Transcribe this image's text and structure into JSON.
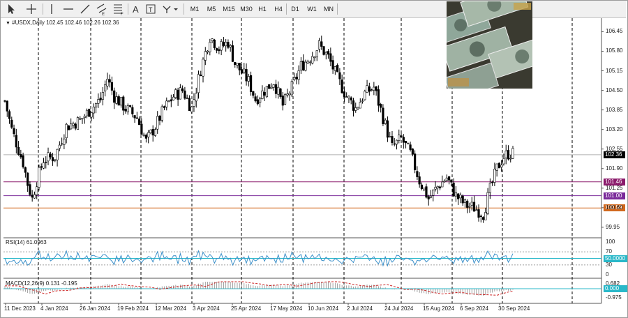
{
  "toolbar": {
    "timeframes": [
      "M1",
      "M5",
      "M15",
      "M30",
      "H1",
      "H4",
      "D1",
      "W1",
      "MN"
    ],
    "icons": [
      "cursor-icon",
      "crosshair-icon",
      "vertical-line-icon",
      "horizontal-line-icon",
      "trend-line-icon",
      "equidistant-channel-icon",
      "fibonacci-icon",
      "text-icon",
      "text-label-icon",
      "shapes-icon"
    ]
  },
  "header": {
    "text": "#USDX,Daily  102.45 102.46 102.26 102.36"
  },
  "price_axis": {
    "labels": [
      "106.45",
      "105.80",
      "105.15",
      "104.50",
      "103.85",
      "103.20",
      "102.55",
      "101.90",
      "101.25",
      "100.60",
      "99.95"
    ],
    "current_price": "102.36",
    "levels": [
      {
        "value": "101.46",
        "color": "#8b1a6b"
      },
      {
        "value": "101.00",
        "color": "#7a2a9a"
      },
      {
        "value": "100.59",
        "color": "#d2691e"
      }
    ]
  },
  "rsi": {
    "title": "RSI(14) 61.0963",
    "axis": [
      "100",
      "70",
      "50.0000",
      "30",
      "0"
    ],
    "line_value": "50.0000"
  },
  "macd": {
    "title": "MACD(12,26,9) 0.131 -0.195",
    "axis": [
      "0.682",
      "0.000",
      "-0.975"
    ]
  },
  "time_axis": [
    "11 Dec 2023",
    "4 Jan 2024",
    "26 Jan 2024",
    "19 Feb 2024",
    "12 Mar 2024",
    "3 Apr 2024",
    "25 Apr 2024",
    "17 May 2024",
    "10 Jun 2024",
    "2 Jul 2024",
    "24 Jul 2024",
    "15 Aug 2024",
    "6 Sep 2024",
    "30 Sep 2024"
  ],
  "colors": {
    "rsi_line": "#3a8fc9",
    "level_line": "#29b8c9",
    "macd_signal": "#cc2222",
    "grid": "#000000"
  },
  "chart_data": {
    "type": "candlestick",
    "symbol": "#USDX",
    "period": "Daily",
    "y_range": [
      99.6,
      106.9
    ],
    "waypoints": [
      [
        0,
        104.15
      ],
      [
        3,
        103.2
      ],
      [
        8,
        102.1
      ],
      [
        10,
        101.4
      ],
      [
        12,
        100.9
      ],
      [
        14,
        101.5
      ],
      [
        17,
        102.2
      ],
      [
        22,
        102.3
      ],
      [
        27,
        103.3
      ],
      [
        33,
        103.5
      ],
      [
        38,
        103.9
      ],
      [
        42,
        104.2
      ],
      [
        45,
        104.9
      ],
      [
        48,
        104.3
      ],
      [
        53,
        103.9
      ],
      [
        58,
        103.6
      ],
      [
        62,
        102.8
      ],
      [
        66,
        103.3
      ],
      [
        70,
        103.9
      ],
      [
        74,
        104.3
      ],
      [
        78,
        104.5
      ],
      [
        82,
        103.9
      ],
      [
        86,
        105.2
      ],
      [
        90,
        106.3
      ],
      [
        94,
        105.9
      ],
      [
        98,
        106.1
      ],
      [
        101,
        105.4
      ],
      [
        104,
        105.1
      ],
      [
        107,
        104.8
      ],
      [
        110,
        104.2
      ],
      [
        114,
        104.5
      ],
      [
        118,
        104.8
      ],
      [
        122,
        104.0
      ],
      [
        126,
        104.6
      ],
      [
        130,
        105.3
      ],
      [
        134,
        105.6
      ],
      [
        138,
        106.0
      ],
      [
        142,
        105.6
      ],
      [
        146,
        104.9
      ],
      [
        150,
        104.3
      ],
      [
        154,
        103.9
      ],
      [
        158,
        104.4
      ],
      [
        162,
        104.6
      ],
      [
        166,
        103.6
      ],
      [
        170,
        102.6
      ],
      [
        174,
        102.9
      ],
      [
        178,
        102.4
      ],
      [
        182,
        101.5
      ],
      [
        186,
        100.9
      ],
      [
        190,
        101.3
      ],
      [
        194,
        101.6
      ],
      [
        198,
        101.0
      ],
      [
        202,
        100.7
      ],
      [
        206,
        100.6
      ],
      [
        210,
        100.4
      ],
      [
        213,
        101.2
      ],
      [
        216,
        101.9
      ],
      [
        219,
        102.3
      ],
      [
        221,
        102.4
      ]
    ]
  }
}
